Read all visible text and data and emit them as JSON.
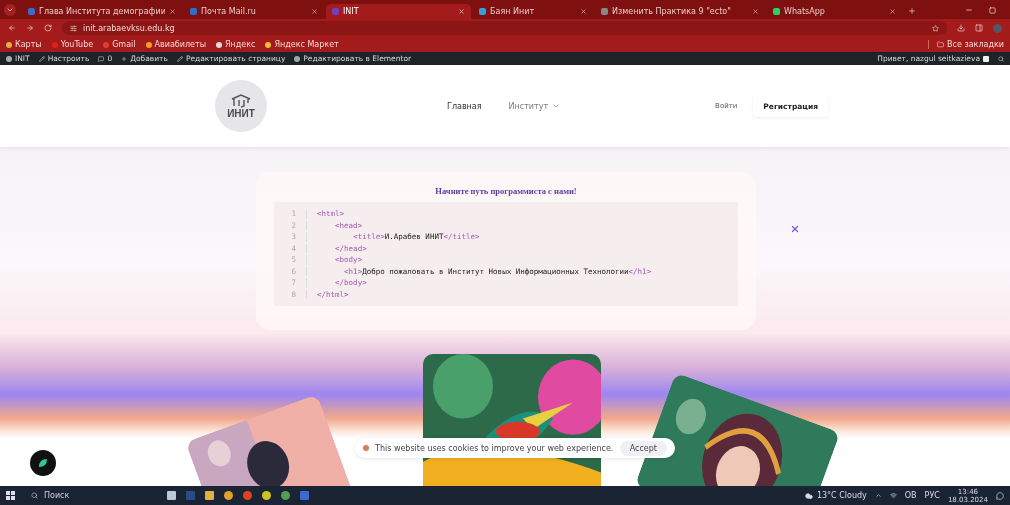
{
  "browser": {
    "tabs": [
      {
        "title": "Глава Института демографии",
        "selected": false
      },
      {
        "title": "Почта Mail.ru",
        "selected": false
      },
      {
        "title": "INIT",
        "selected": true
      },
      {
        "title": "Баян Инит",
        "selected": false
      },
      {
        "title": "Изменить Практика 9 \"ecto\"",
        "selected": false
      },
      {
        "title": "WhatsApp",
        "selected": false
      }
    ],
    "url": "init.arabaevksu.edu.kg",
    "bookmarks": [
      "Карты",
      "YouTube",
      "Gmail",
      "Авиабилеты",
      "Яндекс",
      "Яндекс Маркет"
    ],
    "all_bookmarks": "Все закладки"
  },
  "admin_bar": {
    "site": "INIT",
    "customize": "Настроить",
    "comments": "0",
    "add": "Добавить",
    "edit_page": "Редактировать страницу",
    "edit_elementor": "Редактировать в Elementor",
    "greeting": "Привет, nazgul seitkazieva"
  },
  "site_header": {
    "logo": "ИНИТ",
    "nav": [
      {
        "label": "Главная",
        "dropdown": false
      },
      {
        "label": "Институт",
        "dropdown": true
      }
    ],
    "login": "Войти",
    "register": "Регистрация"
  },
  "hero": {
    "heading": "Начните путь программиста с нами!",
    "code_lines": [
      {
        "number": "1",
        "code": "<html>"
      },
      {
        "number": "2",
        "code": "    <head>"
      },
      {
        "number": "3",
        "code": "        <title>И.Арабев ИНИТ</title>"
      },
      {
        "number": "4",
        "code": "    </head>"
      },
      {
        "number": "5",
        "code": "    <body>"
      },
      {
        "number": "6",
        "code": "      <h1>Добро пожаловать в Институт Новых Информационных Технологии</h1>"
      },
      {
        "number": "7",
        "code": "    </body>"
      },
      {
        "number": "8",
        "code": "</html>"
      }
    ]
  },
  "cookie_notice": {
    "text": "This website uses cookies to improve your web experience.",
    "button": "Accept"
  },
  "taskbar": {
    "search": "Поиск",
    "weather": "13°C Cloudy",
    "tray_language": "РУС",
    "tray_audio": "ОВ",
    "time": "13:46",
    "date": "18.03.2024"
  }
}
